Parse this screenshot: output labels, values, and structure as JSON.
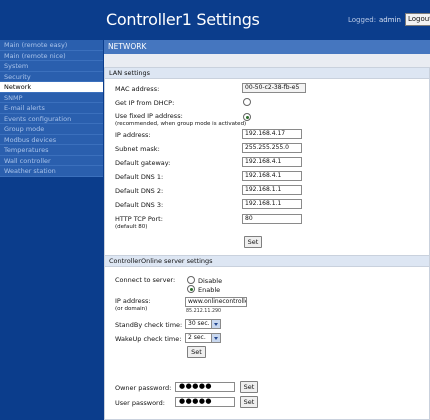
{
  "header": {
    "title": "Controller1 Settings",
    "logged_label": "Logged:",
    "logged_user": "admin",
    "logout_label": "Logout"
  },
  "sidebar": {
    "items": [
      {
        "label": "Main (remote easy)"
      },
      {
        "label": "Main (remote nice)"
      },
      {
        "label": "System"
      },
      {
        "label": "Security"
      },
      {
        "label": "Network"
      },
      {
        "label": "SNMP"
      },
      {
        "label": "E-mail alerts"
      },
      {
        "label": "Events configuration"
      },
      {
        "label": "Group mode"
      },
      {
        "label": "Modbus devices"
      },
      {
        "label": "Temperatures"
      },
      {
        "label": "Wall controller"
      },
      {
        "label": "Weather station"
      }
    ],
    "active": "Network"
  },
  "main": {
    "section_title": "NETWORK",
    "lan": {
      "title": "LAN settings",
      "mac_label": "MAC address:",
      "mac_value": "00-50-c2-38-fb-e5",
      "dhcp_label": "Get IP from DHCP:",
      "fixed_label": "Use fixed IP address:",
      "fixed_sub": "(recommended, when group mode is activated)",
      "ip_label": "IP address:",
      "ip_value": "192.168.4.17",
      "mask_label": "Subnet mask:",
      "mask_value": "255.255.255.0",
      "gateway_label": "Default gateway:",
      "gateway_value": "192.168.4.1",
      "dns1_label": "Default DNS 1:",
      "dns1_value": "192.168.4.1",
      "dns2_label": "Default DNS 2:",
      "dns2_value": "192.168.1.1",
      "dns3_label": "Default DNS 3:",
      "dns3_value": "192.168.1.1",
      "http_label": "HTTP TCP Port:",
      "http_sub": "(default 80)",
      "http_value": "80",
      "set_label": "Set"
    },
    "server": {
      "title": "ControllerOnline server settings",
      "connect_label": "Connect to server:",
      "disable_label": "Disable",
      "enable_label": "Enable",
      "ip_label": "IP address:",
      "ip_sub": "(or domain)",
      "ip_value": "www.onlinecontrolle",
      "ip_note": "85.212.11.290",
      "standby_label": "StandBy check time:",
      "standby_value": "30 sec.",
      "wakeup_label": "WakeUp check time:",
      "wakeup_value": "2 sec.",
      "set_label": "Set",
      "owner_pw_label": "Owner password:",
      "owner_pw_value": "●●●●●",
      "owner_set_label": "Set",
      "user_pw_label": "User password:",
      "user_pw_value": "●●●●●",
      "user_set_label": "Set"
    }
  },
  "colors": {
    "header_bg": "#0b3d8c",
    "sidebar_item_bg": "#2a5fae",
    "section_header_bg": "#4576bf",
    "panel_title_bg": "#dde6f3"
  }
}
